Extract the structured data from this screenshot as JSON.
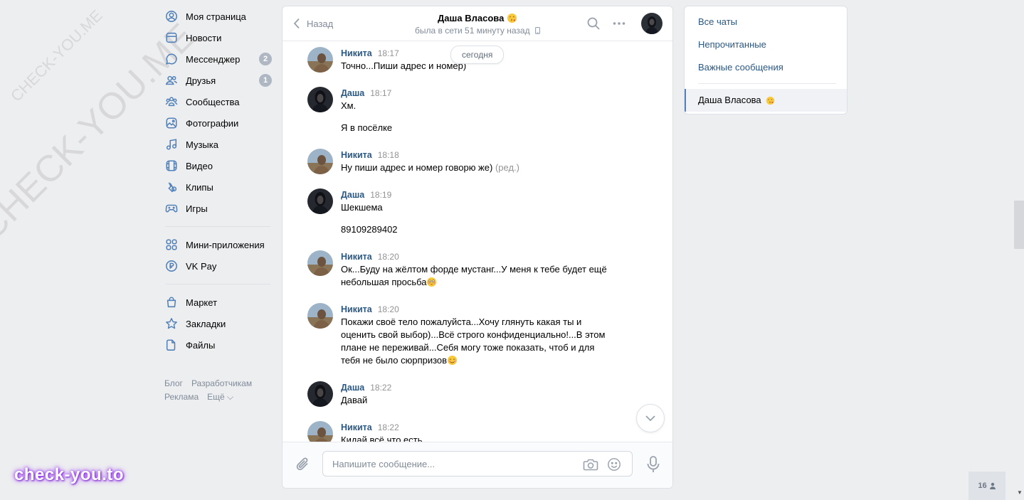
{
  "sidebar": {
    "items": [
      {
        "label": "Моя страница",
        "icon": "user-circle-icon"
      },
      {
        "label": "Новости",
        "icon": "news-icon"
      },
      {
        "label": "Мессенджер",
        "icon": "chat-bubble-icon",
        "counter": "2"
      },
      {
        "label": "Друзья",
        "icon": "friends-icon",
        "counter": "1"
      },
      {
        "label": "Сообщества",
        "icon": "community-icon"
      },
      {
        "label": "Фотографии",
        "icon": "photo-icon"
      },
      {
        "label": "Музыка",
        "icon": "music-note-icon"
      },
      {
        "label": "Видео",
        "icon": "video-icon"
      },
      {
        "label": "Клипы",
        "icon": "clips-icon"
      },
      {
        "label": "Игры",
        "icon": "gamepad-icon"
      },
      {
        "label": "Мини-приложения",
        "icon": "grid-apps-icon"
      },
      {
        "label": "VK Pay",
        "icon": "vkpay-icon"
      },
      {
        "label": "Маркет",
        "icon": "shopping-bag-icon"
      },
      {
        "label": "Закладки",
        "icon": "star-icon"
      },
      {
        "label": "Файлы",
        "icon": "file-icon"
      }
    ],
    "footer": [
      "Блог",
      "Разработчикам",
      "Реклама",
      "Ещё ⌵"
    ]
  },
  "watermarks": {
    "small": "CHECK-YOU.ME",
    "large": "CHECK-YOU.ME",
    "brand": "check-you.to"
  },
  "chat": {
    "back_label": "Назад",
    "peer_name": "Даша Власова",
    "peer_status": "была в сети 51 минуту назад",
    "date_pill": "сегодня",
    "messages": [
      {
        "author": "Никита",
        "time": "18:17",
        "lines": [
          "Точно...Пиши адрес и номер)"
        ]
      },
      {
        "author": "Даша",
        "time": "18:17",
        "lines": [
          "Хм.",
          "Я в посёлке"
        ]
      },
      {
        "author": "Никита",
        "time": "18:18",
        "lines": [
          "Ну пиши адрес и номер говорю же)"
        ],
        "edited": "(ред.)"
      },
      {
        "author": "Даша",
        "time": "18:19",
        "lines": [
          "Шекшема",
          "89109289402"
        ]
      },
      {
        "author": "Никита",
        "time": "18:20",
        "lines": [
          "Ок...Буду на жёлтом форде мустанг...У меня к тебе будет ещё небольшая просьба"
        ]
      },
      {
        "author": "Никита",
        "time": "18:20",
        "lines": [
          "Покажи своё тело пожалуйста...Хочу глянуть какая ты и оценить свой выбор)...Всё строго конфиденциально!...В этом плане не переживай...Себя могу тоже показать, чтоб и для тебя не было сюрпризов"
        ]
      },
      {
        "author": "Даша",
        "time": "18:22",
        "lines": [
          "Давай"
        ]
      },
      {
        "author": "Никита",
        "time": "18:22",
        "lines": [
          "Кидай всё что есть"
        ]
      }
    ],
    "composer_placeholder": "Напишите сообщение..."
  },
  "folders": {
    "items": [
      "Все чаты",
      "Непрочитанные",
      "Важные сообщения"
    ],
    "active_chat": "Даша Власова"
  },
  "online_count": "16",
  "colors": {
    "link": "#2a5885",
    "accent": "#5181b8",
    "bg": "#edeef0"
  }
}
